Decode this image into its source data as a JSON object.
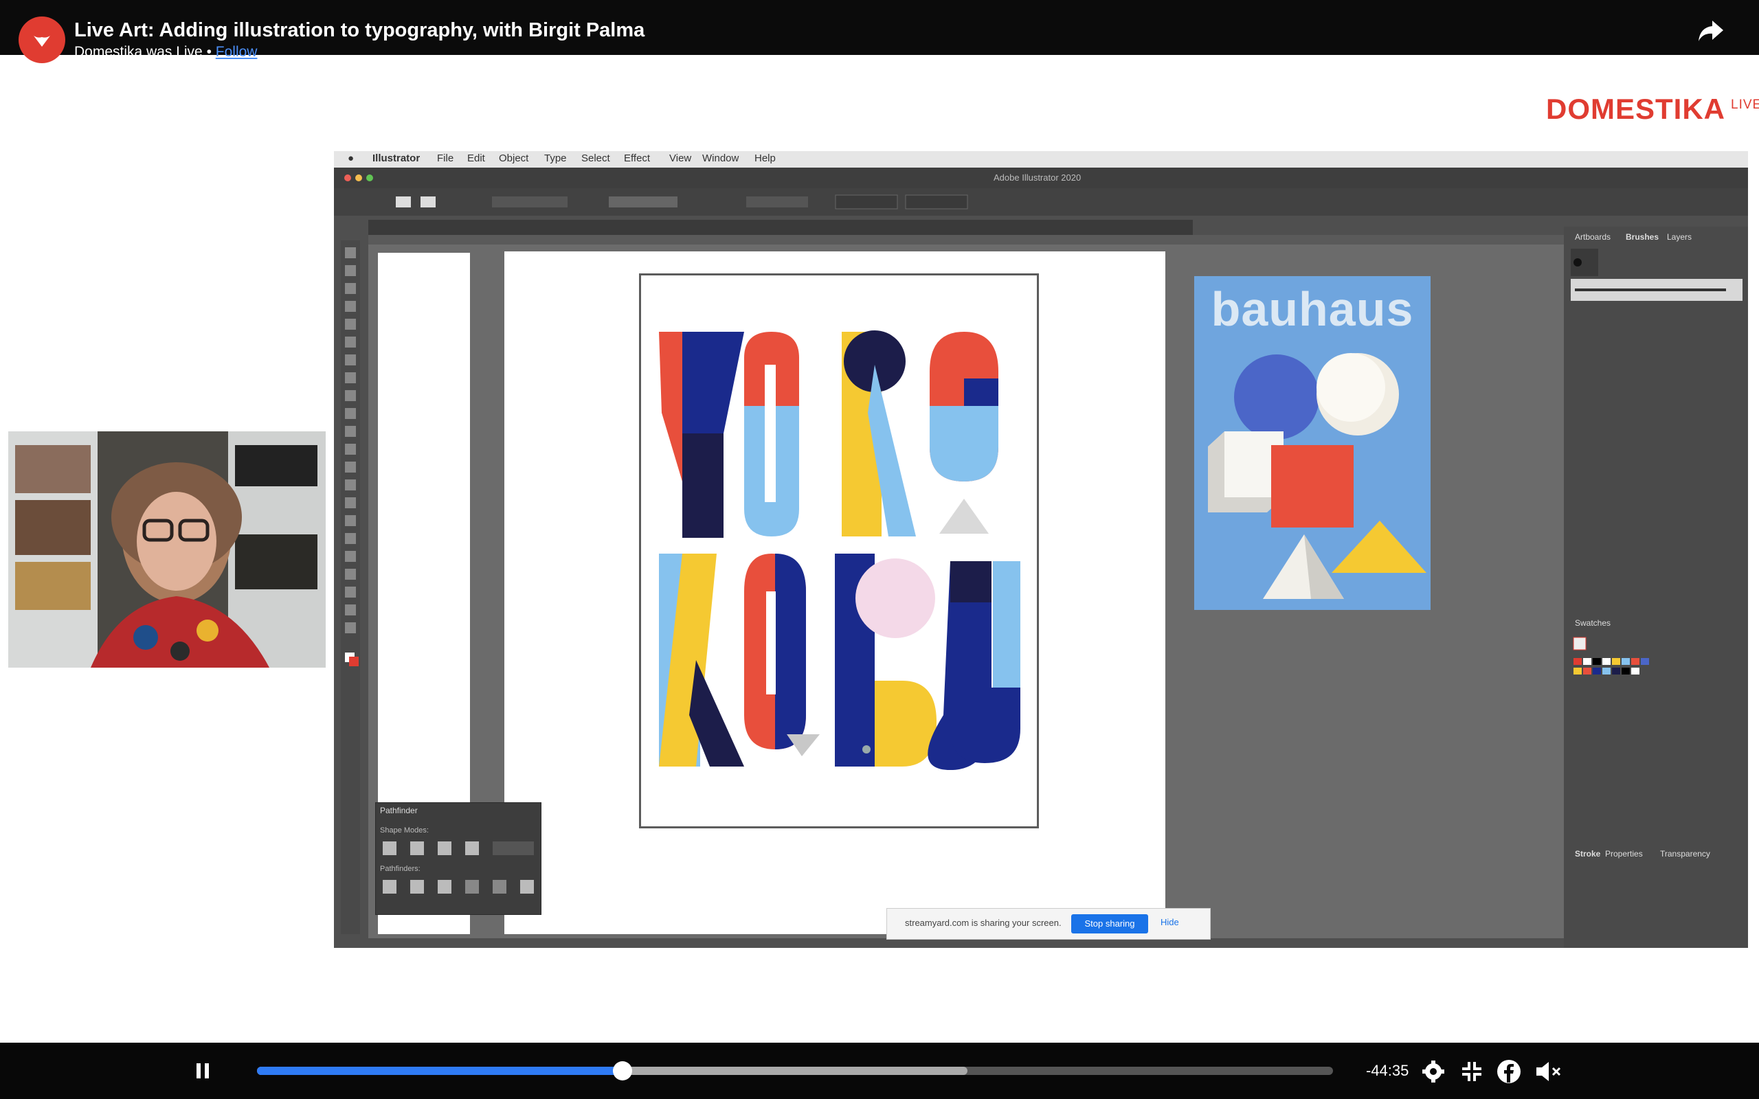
{
  "header": {
    "title": "Live Art: Adding illustration to typography, with Birgit Palma",
    "subtitle": "Domestika was Live •",
    "follow": "Follow",
    "share_icon": "share-arrow-icon"
  },
  "brand": {
    "name": "DOMESTIKA",
    "live": "LIVE",
    "dot": "●",
    "color": "#e03c31"
  },
  "macos_menubar": {
    "items": [
      "Illustrator",
      "File",
      "Edit",
      "Object",
      "Type",
      "Select",
      "Effect",
      "View",
      "Window",
      "Help"
    ]
  },
  "illustrator": {
    "workspace_title": "Adobe Illustrator 2020",
    "panel_tabs": [
      "Artboards",
      "Brushes",
      "Layers"
    ],
    "swatches_tab": "Swatches",
    "lower_tabs": [
      "Stroke",
      "Properties",
      "Transparency"
    ],
    "pathfinder": {
      "title": "Pathfinder",
      "shape_modes": "Shape Modes:",
      "pathfinders": "Pathfinders:"
    },
    "artwork_letters": [
      "YOKO",
      "KOBU"
    ]
  },
  "bauhaus_poster": {
    "title": "bauhaus"
  },
  "screen_share_bar": {
    "text": "streamyard.com is sharing your screen.",
    "stop_label": "Stop sharing",
    "hide_label": "Hide"
  },
  "player": {
    "time_remaining": "-44:35",
    "progress_played": 0.34,
    "progress_buffered": 0.66,
    "icons": [
      "pause-icon",
      "settings-icon",
      "exit-fullscreen-icon",
      "facebook-icon",
      "volume-muted-icon"
    ]
  }
}
